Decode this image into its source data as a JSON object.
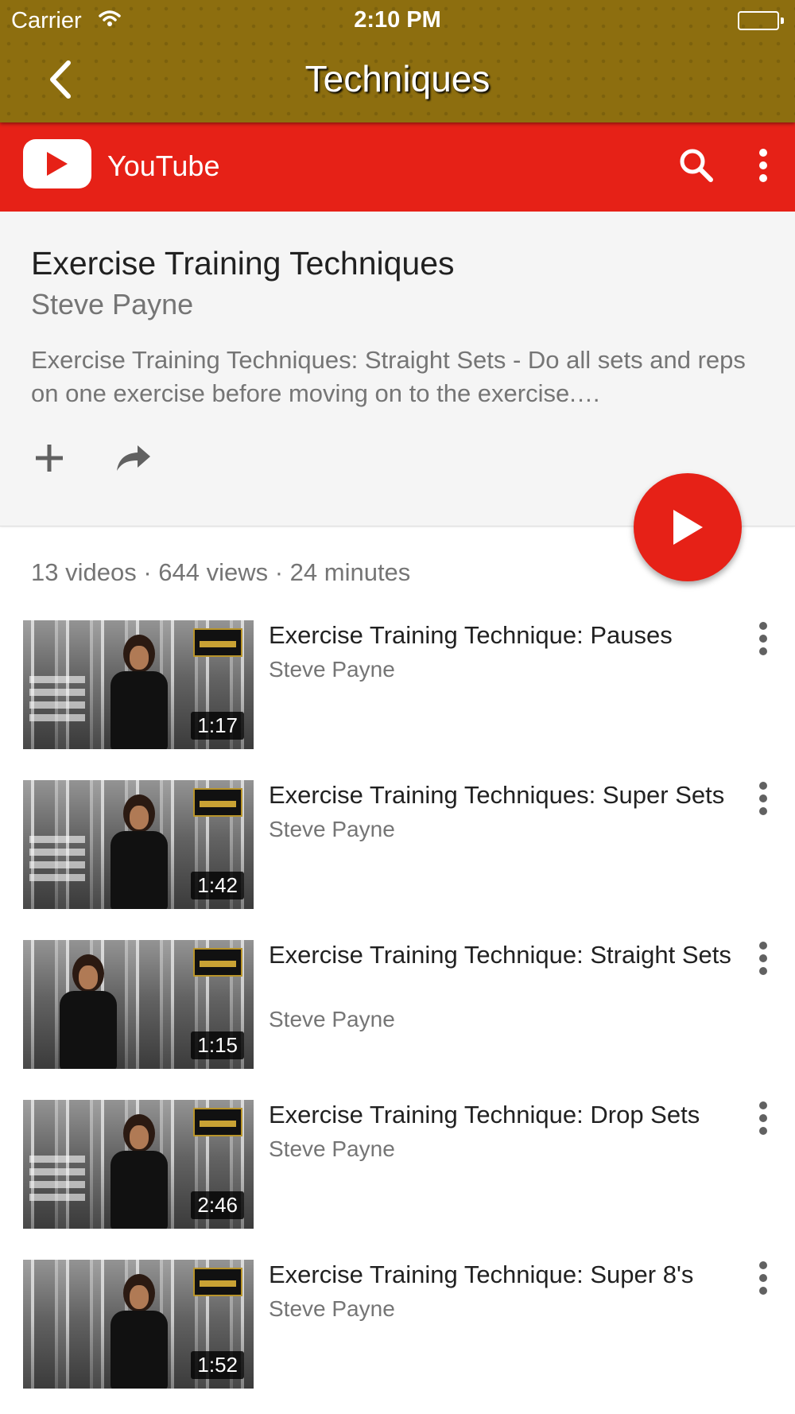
{
  "status_bar": {
    "carrier": "Carrier",
    "time": "2:10 PM"
  },
  "nav": {
    "title": "Techniques",
    "back_icon": "chevron-left-icon"
  },
  "youtube_bar": {
    "label": "YouTube",
    "search_icon": "search-icon",
    "menu_icon": "more-vert-icon"
  },
  "playlist": {
    "title": "Exercise Training Techniques",
    "owner": "Steve Payne",
    "description": "Exercise Training Techniques: Straight Sets - Do all sets and reps on one exercise before moving on to the exercise.…",
    "stats": "13 videos · 644 views · 24 minutes"
  },
  "colors": {
    "header": "#8d6e0f",
    "youtube_red": "#e62117",
    "card_bg": "#f5f5f5",
    "secondary_text": "#757575"
  },
  "videos": [
    {
      "title": "Exercise Training Technique: Pauses",
      "channel": "Steve Payne",
      "duration": "1:17"
    },
    {
      "title": "Exercise Training Techniques: Super Sets",
      "channel": "Steve Payne",
      "duration": "1:42"
    },
    {
      "title": "Exercise Training Technique: Straight Sets",
      "channel": "Steve Payne",
      "duration": "1:15"
    },
    {
      "title": "Exercise Training Technique: Drop Sets",
      "channel": "Steve Payne",
      "duration": "2:46"
    },
    {
      "title": "Exercise Training Technique: Super 8's",
      "channel": "Steve Payne",
      "duration": "1:52"
    }
  ]
}
